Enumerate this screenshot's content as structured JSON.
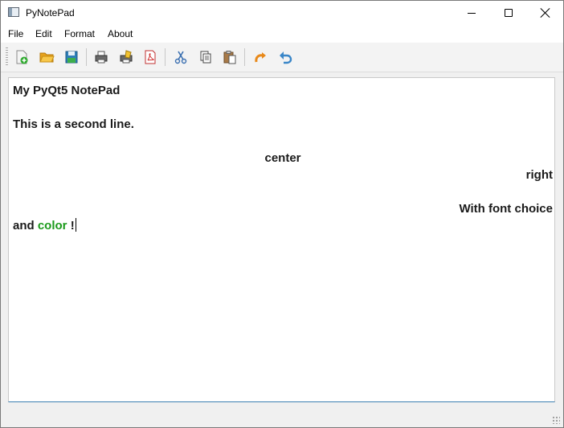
{
  "window": {
    "title": "PyNotePad"
  },
  "menu": {
    "items": [
      "File",
      "Edit",
      "Format",
      "About"
    ]
  },
  "toolbar": {
    "icons": [
      "new-file-icon",
      "open-folder-icon",
      "save-icon",
      "print-icon",
      "print-preview-icon",
      "export-pdf-icon",
      "cut-icon",
      "copy-icon",
      "paste-icon",
      "redo-icon",
      "undo-icon"
    ]
  },
  "document": {
    "line1": "My PyQt5 NotePad",
    "line2": "This is a second line.",
    "line3": "center",
    "line4": "right",
    "line5": "With font choice",
    "line6_prefix": "and ",
    "line6_colored": "color",
    "line6_suffix": " !",
    "colored_text_color": "#1a9a1a"
  }
}
